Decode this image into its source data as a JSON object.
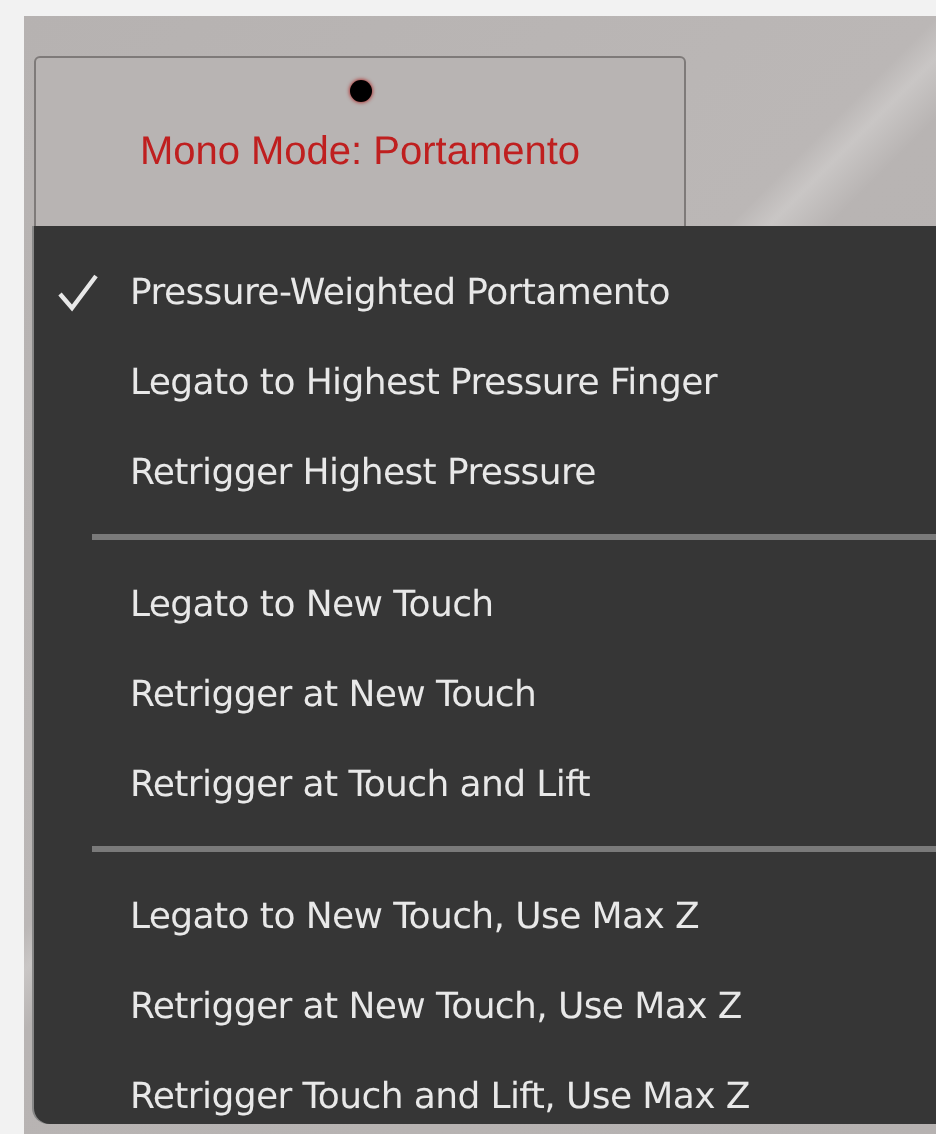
{
  "mode_button": {
    "label": "Mono Mode: Portamento"
  },
  "menu": {
    "groups": [
      {
        "items": [
          {
            "label": "Pressure-Weighted Portamento",
            "checked": true
          },
          {
            "label": "Legato to Highest Pressure Finger",
            "checked": false
          },
          {
            "label": "Retrigger Highest Pressure",
            "checked": false
          }
        ]
      },
      {
        "items": [
          {
            "label": "Legato to New Touch",
            "checked": false
          },
          {
            "label": "Retrigger at New Touch",
            "checked": false
          },
          {
            "label": "Retrigger at Touch and Lift",
            "checked": false
          }
        ]
      },
      {
        "items": [
          {
            "label": "Legato to New Touch, Use Max Z",
            "checked": false
          },
          {
            "label": "Retrigger at New Touch, Use Max Z",
            "checked": false
          },
          {
            "label": "Retrigger Touch and Lift, Use Max Z",
            "checked": false
          }
        ]
      }
    ]
  }
}
